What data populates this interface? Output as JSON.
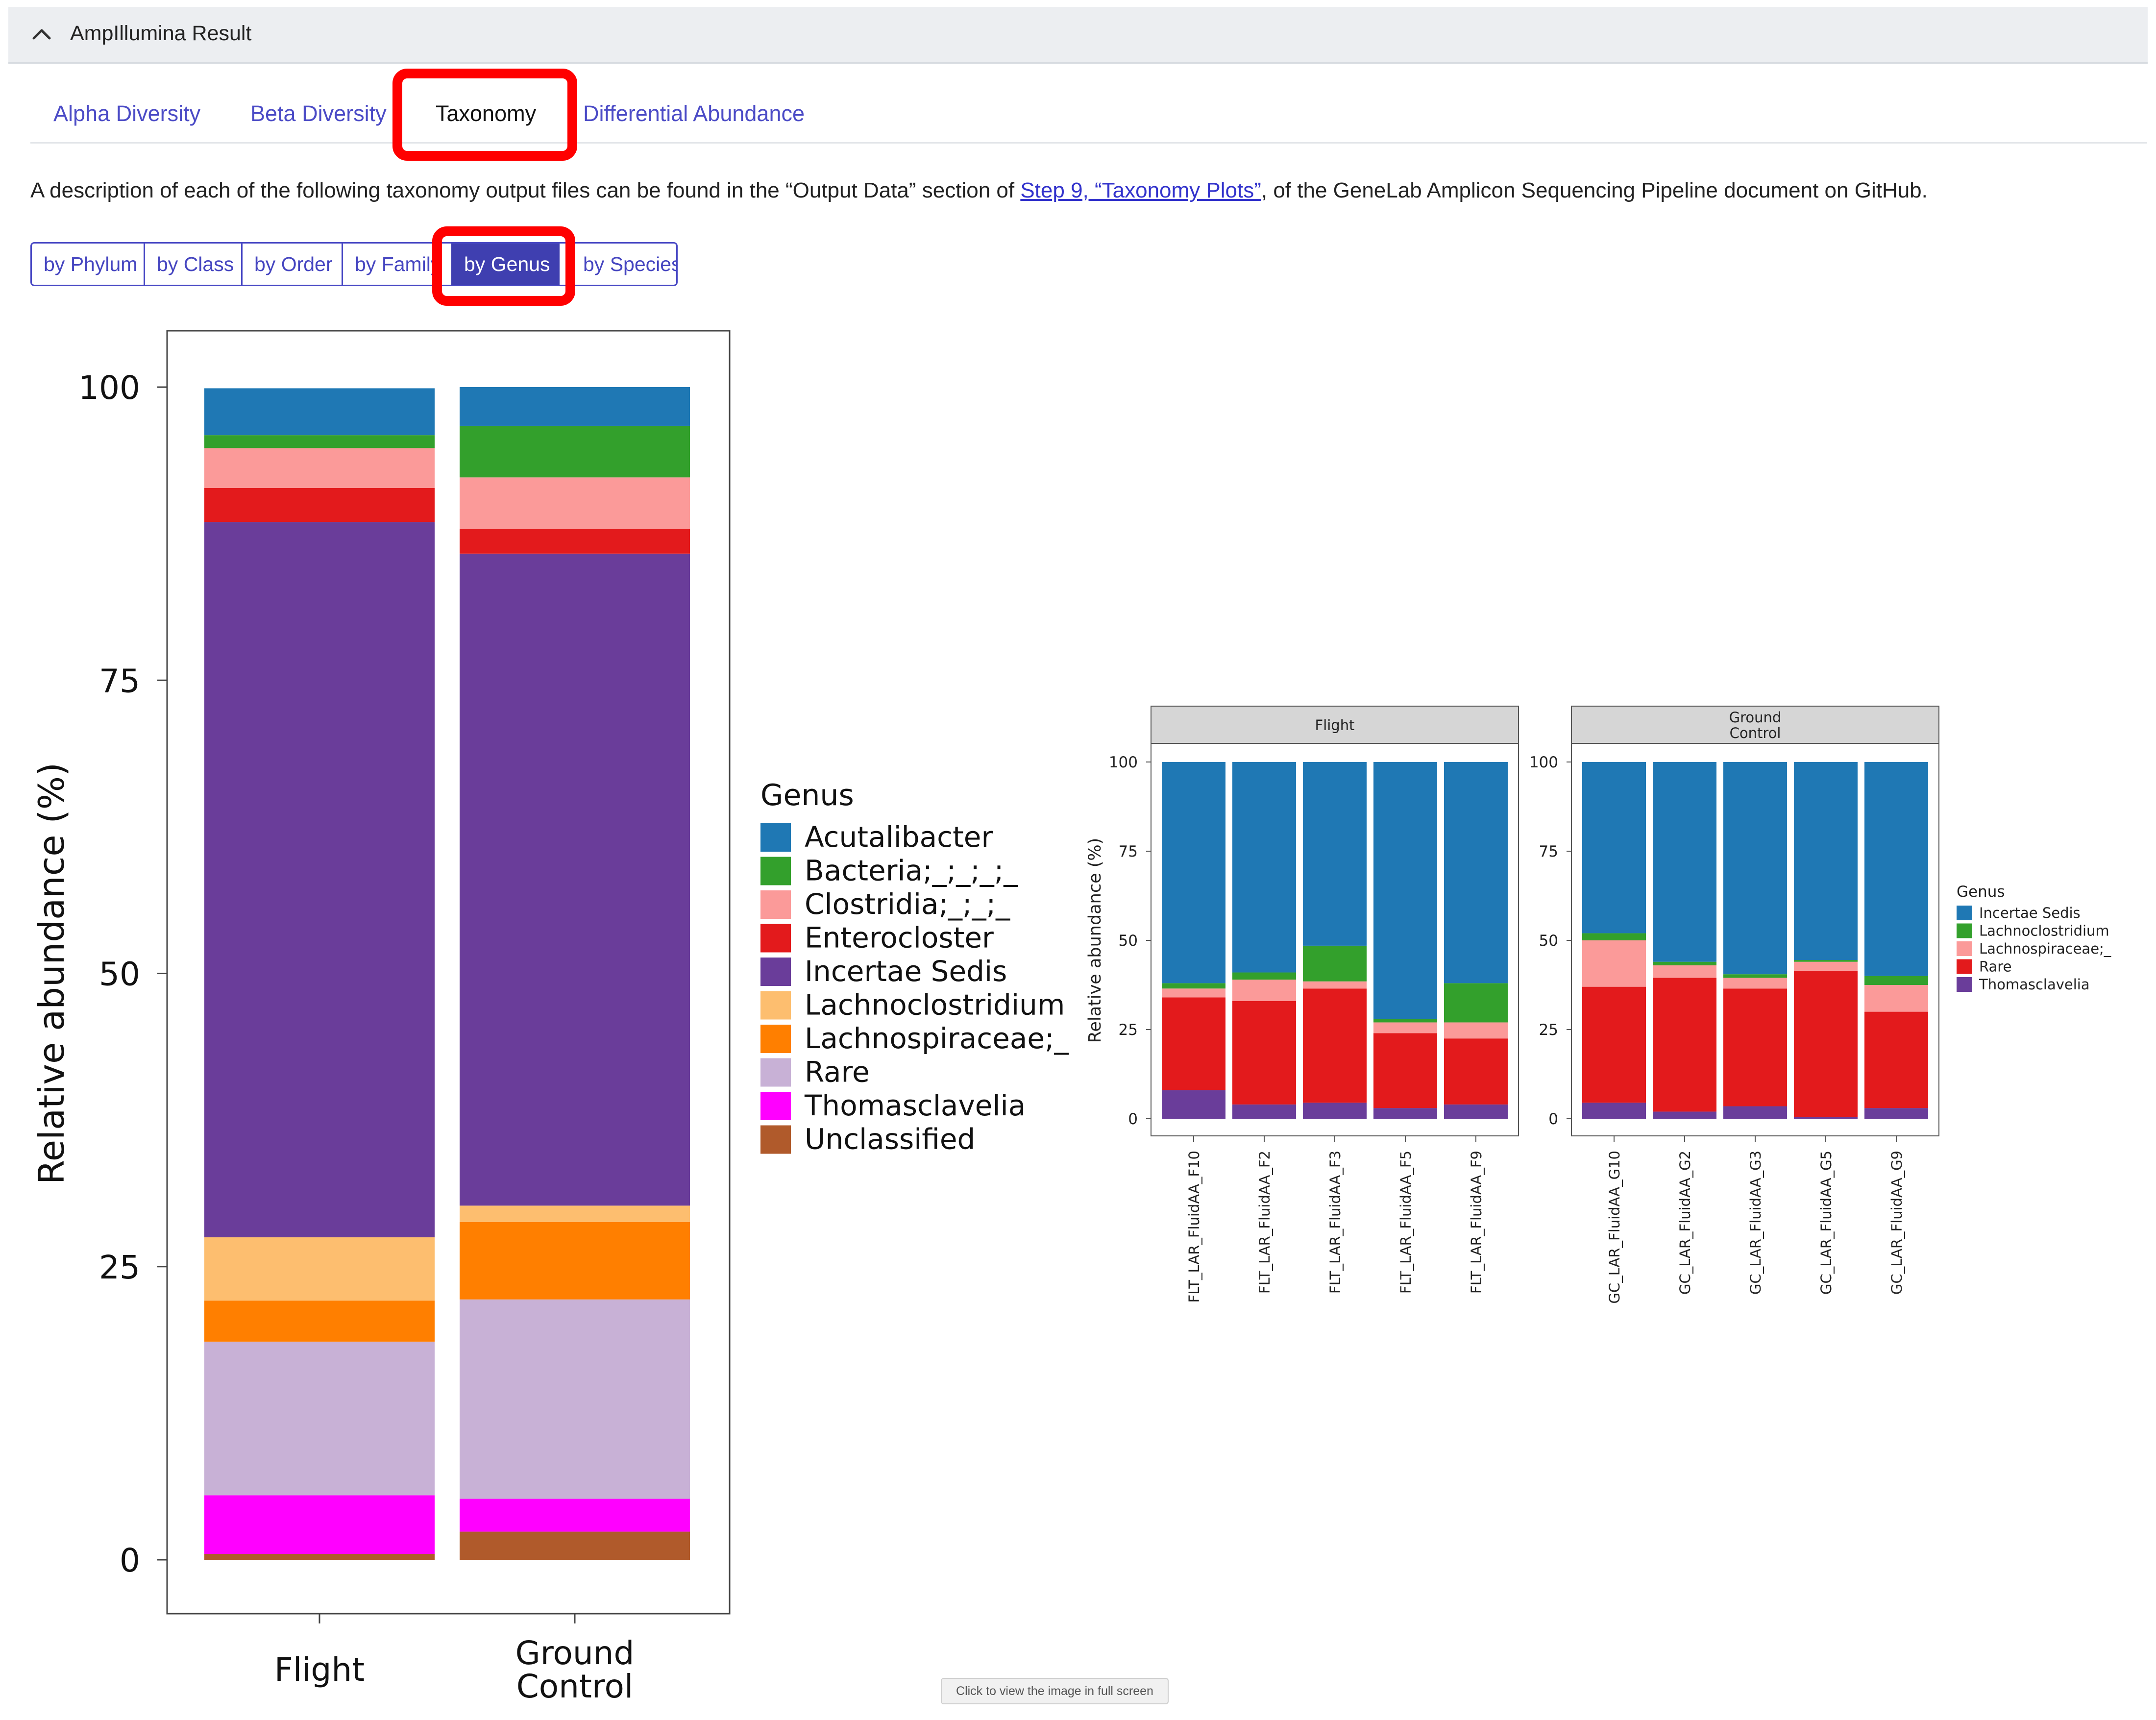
{
  "header": {
    "title": "AmpIllumina Result"
  },
  "tabs": [
    {
      "label": "Alpha Diversity",
      "active": false
    },
    {
      "label": "Beta Diversity",
      "active": false
    },
    {
      "label": "Taxonomy",
      "active": true
    },
    {
      "label": "Differential Abundance",
      "active": false
    }
  ],
  "description": {
    "before": "A description of each of the following taxonomy output files can be found in the “Output Data” section of ",
    "link": "Step 9, “Taxonomy Plots”",
    "after": ", of the GeneLab Amplicon Sequencing Pipeline document on GitHub."
  },
  "rank_buttons": [
    {
      "label": "by Phylum",
      "active": false
    },
    {
      "label": "by Class",
      "active": false
    },
    {
      "label": "by Order",
      "active": false
    },
    {
      "label": "by Family",
      "active": false
    },
    {
      "label": "by Genus",
      "active": true
    },
    {
      "label": "by Species",
      "active": false
    }
  ],
  "tooltip": "Click to view the image in full screen",
  "chart_data": [
    {
      "type": "bar",
      "stacked": true,
      "ylabel": "Relative abundance (%)",
      "yticks": [
        0,
        25,
        50,
        75,
        100
      ],
      "ylim": [
        0,
        100
      ],
      "categories": [
        [
          "Flight"
        ],
        [
          "Ground",
          "Control"
        ]
      ],
      "legend_title": "Genus",
      "legend_position": "right",
      "series": [
        {
          "name": "Unclassified",
          "color": "#b05a2b",
          "values": [
            0.5,
            2.4
          ]
        },
        {
          "name": "Thomasclavelia",
          "color": "#ff00ff",
          "values": [
            5.0,
            2.8
          ]
        },
        {
          "name": "Rare",
          "color": "#c8b1d6",
          "values": [
            13.1,
            17.0
          ]
        },
        {
          "name": "Lachnospiraceae;_",
          "color": "#ff7f00",
          "values": [
            3.5,
            6.6
          ]
        },
        {
          "name": "Lachnoclostridium",
          "color": "#fdbe6f",
          "values": [
            5.4,
            1.4
          ]
        },
        {
          "name": "Incertae Sedis",
          "color": "#6a3d9a",
          "values": [
            61.0,
            55.6
          ]
        },
        {
          "name": "Enterocloster",
          "color": "#e31a1c",
          "values": [
            2.9,
            2.1
          ]
        },
        {
          "name": "Clostridia;_;_;_",
          "color": "#fb9a99",
          "values": [
            3.4,
            4.4
          ]
        },
        {
          "name": "Bacteria;_;_;_;_",
          "color": "#33a02c",
          "values": [
            1.1,
            4.4
          ]
        },
        {
          "name": "Acutalibacter",
          "color": "#1f78b4",
          "values": [
            4.0,
            3.3
          ]
        }
      ],
      "legend_order": [
        "Acutalibacter",
        "Bacteria;_;_;_;_",
        "Clostridia;_;_;_",
        "Enterocloster",
        "Incertae Sedis",
        "Lachnoclostridium",
        "Lachnospiraceae;_",
        "Rare",
        "Thomasclavelia",
        "Unclassified"
      ]
    },
    {
      "type": "bar",
      "stacked": true,
      "faceted": true,
      "ylabel": "Relative abundance (%)",
      "yticks": [
        0,
        25,
        50,
        75,
        100
      ],
      "ylim": [
        0,
        100
      ],
      "legend_title": "Genus",
      "legend_position": "right",
      "facets": [
        {
          "label": [
            "Flight"
          ],
          "samples": [
            "FLT_LAR_FluidAA_F10",
            "FLT_LAR_FluidAA_F2",
            "FLT_LAR_FluidAA_F3",
            "FLT_LAR_FluidAA_F5",
            "FLT_LAR_FluidAA_F9"
          ]
        },
        {
          "label": [
            "Ground",
            "Control"
          ],
          "samples": [
            "GC_LAR_FluidAA_G10",
            "GC_LAR_FluidAA_G2",
            "GC_LAR_FluidAA_G3",
            "GC_LAR_FluidAA_G5",
            "GC_LAR_FluidAA_G9"
          ]
        }
      ],
      "series": [
        {
          "name": "Thomasclavelia",
          "color": "#6a3d9a",
          "values": [
            8,
            4,
            4.5,
            3,
            4,
            4.5,
            2,
            3.5,
            0.5,
            3
          ]
        },
        {
          "name": "Rare",
          "color": "#e31a1c",
          "values": [
            26,
            29,
            32,
            21,
            18.5,
            32.5,
            37.5,
            33,
            41,
            27
          ]
        },
        {
          "name": "Lachnospiraceae;_",
          "color": "#fb9a99",
          "values": [
            2.5,
            6,
            2,
            3,
            4.5,
            13,
            3.5,
            3,
            2.5,
            7.5
          ]
        },
        {
          "name": "Lachnoclostridium",
          "color": "#33a02c",
          "values": [
            1.5,
            2,
            10,
            1,
            11,
            2,
            1,
            1,
            0.5,
            2.5
          ]
        },
        {
          "name": "Incertae Sedis",
          "color": "#1f78b4",
          "values": [
            62,
            59,
            51.5,
            72,
            62,
            48,
            56,
            59.5,
            55.5,
            60
          ]
        }
      ],
      "legend_order": [
        "Incertae Sedis",
        "Lachnoclostridium",
        "Lachnospiraceae;_",
        "Rare",
        "Thomasclavelia"
      ]
    }
  ]
}
